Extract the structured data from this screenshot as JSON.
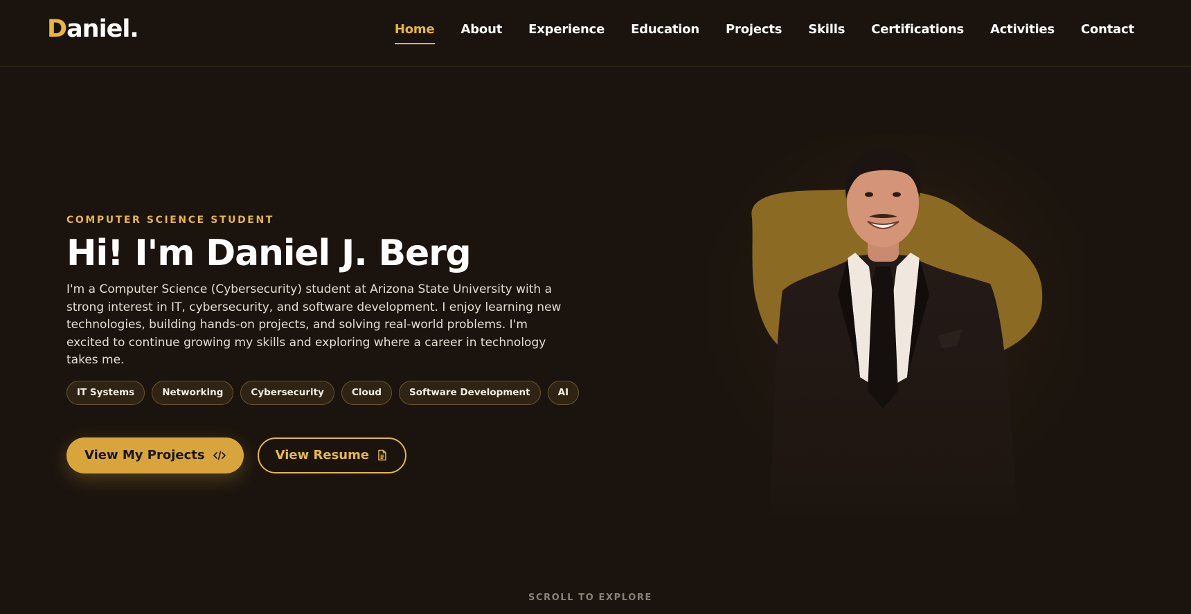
{
  "brand": {
    "logo_initial": "D",
    "logo_rest": "aniel."
  },
  "nav": {
    "items": [
      {
        "label": "Home",
        "active": true
      },
      {
        "label": "About"
      },
      {
        "label": "Experience"
      },
      {
        "label": "Education"
      },
      {
        "label": "Projects"
      },
      {
        "label": "Skills"
      },
      {
        "label": "Certifications"
      },
      {
        "label": "Activities"
      },
      {
        "label": "Contact"
      }
    ]
  },
  "hero": {
    "eyebrow": "COMPUTER SCIENCE STUDENT",
    "title": "Hi! I'm Daniel J. Berg",
    "bio": "I'm a Computer Science (Cybersecurity) student at Arizona State University with a strong interest in IT, cybersecurity, and software development. I enjoy learning new technologies, building hands-on projects, and solving real-world problems. I'm excited to continue growing my skills and exploring where a career in technology takes me.",
    "tags": [
      "IT Systems",
      "Networking",
      "Cybersecurity",
      "Cloud",
      "Software Development",
      "AI"
    ],
    "primary_button": {
      "label": "View My Projects",
      "icon": "code-icon"
    },
    "secondary_button": {
      "label": "View Resume",
      "icon": "document-icon"
    }
  },
  "scroll_hint": "SCROLL TO EXPLORE",
  "colors": {
    "background": "#1b140e",
    "accent": "#e8b73e",
    "button_fill": "#d8a43c",
    "blob": "#8b6a24"
  }
}
